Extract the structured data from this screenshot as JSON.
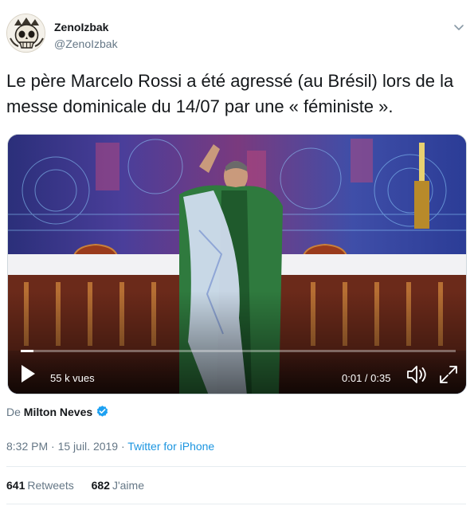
{
  "author": {
    "display_name": "ZenoIzbak",
    "handle": "@ZenoIzbak",
    "avatar_icon": "skull-illustration-avatar"
  },
  "tweet": {
    "text": "Le père Marcelo Rossi a été agressé (au Brésil) lors de la messe dominicale du 14/07 par une « féministe »."
  },
  "video": {
    "views_label": "55 k vues",
    "time_label": "0:01 / 0:35",
    "progress": 0.03,
    "icons": [
      "play-icon",
      "volume-icon",
      "fullscreen-icon"
    ]
  },
  "attribution": {
    "prefix": "De",
    "source_name": "Milton Neves",
    "verified": true
  },
  "meta": {
    "timestamp": "8:32 PM · 15 juil. 2019 · ",
    "app": "Twitter for iPhone"
  },
  "stats": {
    "retweets_count": "641",
    "retweets_label": "Retweets",
    "likes_count": "682",
    "likes_label": "J'aime"
  },
  "colors": {
    "link": "#1b95e0",
    "secondary_text": "#657786",
    "verified": "#1da1f2",
    "vestment_green": "#2f7a3e"
  }
}
